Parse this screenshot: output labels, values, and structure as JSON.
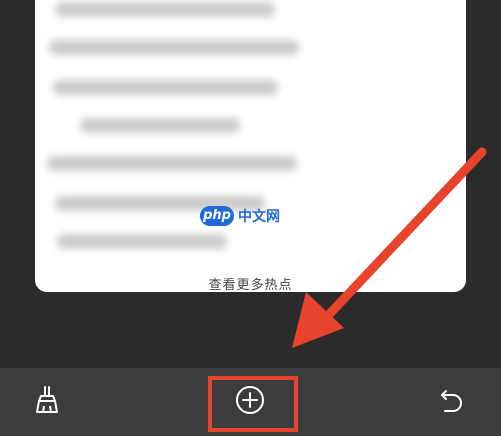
{
  "card": {
    "more_hot_link": "查看更多热点"
  },
  "watermark": {
    "logo_text": "php",
    "site_text": "中文网"
  },
  "toolbar": {
    "left_icon": "broom-icon",
    "center_icon": "add-circle-icon",
    "right_icon": "undo-icon"
  },
  "colors": {
    "annotation": "#e8432c",
    "toolbar_bg": "#3c3c3c",
    "page_bg": "#2b2b2b"
  }
}
